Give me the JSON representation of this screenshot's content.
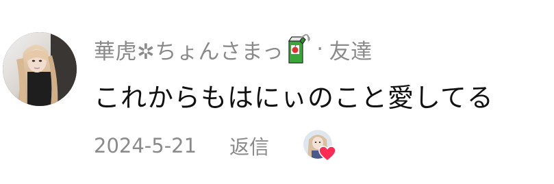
{
  "comment": {
    "author_name": "華虎✲ちょんさまっ",
    "author_badge_icon": "juice-box-icon",
    "separator": "·",
    "relationship": "友達",
    "text": "これからもはにぃのこと愛してる",
    "date": "2024-5-21",
    "reply_label": "返信",
    "liked_by_author_icon": "heart-icon"
  },
  "colors": {
    "secondary_text": "#8a8a8a",
    "primary_text": "#111111",
    "heart": "#fe2c55",
    "background": "#ffffff"
  }
}
